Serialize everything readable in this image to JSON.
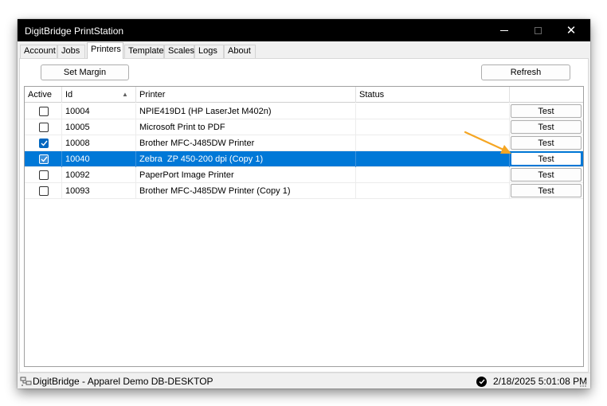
{
  "window": {
    "title": "DigitBridge PrintStation"
  },
  "tabs": [
    {
      "label": "Account",
      "active": false
    },
    {
      "label": "Jobs",
      "active": false
    },
    {
      "label": "Printers",
      "active": true
    },
    {
      "label": "Template",
      "active": false
    },
    {
      "label": "Scales",
      "active": false
    },
    {
      "label": "Logs",
      "active": false
    },
    {
      "label": "About",
      "active": false
    }
  ],
  "toolbar": {
    "set_margin_label": "Set Margin",
    "refresh_label": "Refresh"
  },
  "grid": {
    "columns": [
      "Active",
      "Id",
      "Printer",
      "Status",
      ""
    ],
    "rows": [
      {
        "active": false,
        "id": "10004",
        "printer": "NPIE419D1 (HP LaserJet M402n)",
        "status": "",
        "action": "Test",
        "selected": false
      },
      {
        "active": false,
        "id": "10005",
        "printer": "Microsoft Print to PDF",
        "status": "",
        "action": "Test",
        "selected": false
      },
      {
        "active": true,
        "id": "10008",
        "printer": "Brother MFC-J485DW Printer",
        "status": "",
        "action": "Test",
        "selected": false
      },
      {
        "active": true,
        "id": "10040",
        "printer": "Zebra  ZP 450-200 dpi (Copy 1)",
        "status": "",
        "action": "Test",
        "selected": true
      },
      {
        "active": false,
        "id": "10092",
        "printer": "PaperPort Image Printer",
        "status": "",
        "action": "Test",
        "selected": false
      },
      {
        "active": false,
        "id": "10093",
        "printer": "Brother MFC-J485DW Printer (Copy 1)",
        "status": "",
        "action": "Test",
        "selected": false
      }
    ]
  },
  "statusbar": {
    "left_text": "DigitBridge - Apparel Demo  DB-DESKTOP",
    "right_text": "2/18/2025 5:01:08 PM"
  },
  "colors": {
    "titlebar": "#000000",
    "selection": "#0078d7",
    "checkbox_checked": "#0067c0",
    "annotation_arrow": "#f5a623"
  }
}
